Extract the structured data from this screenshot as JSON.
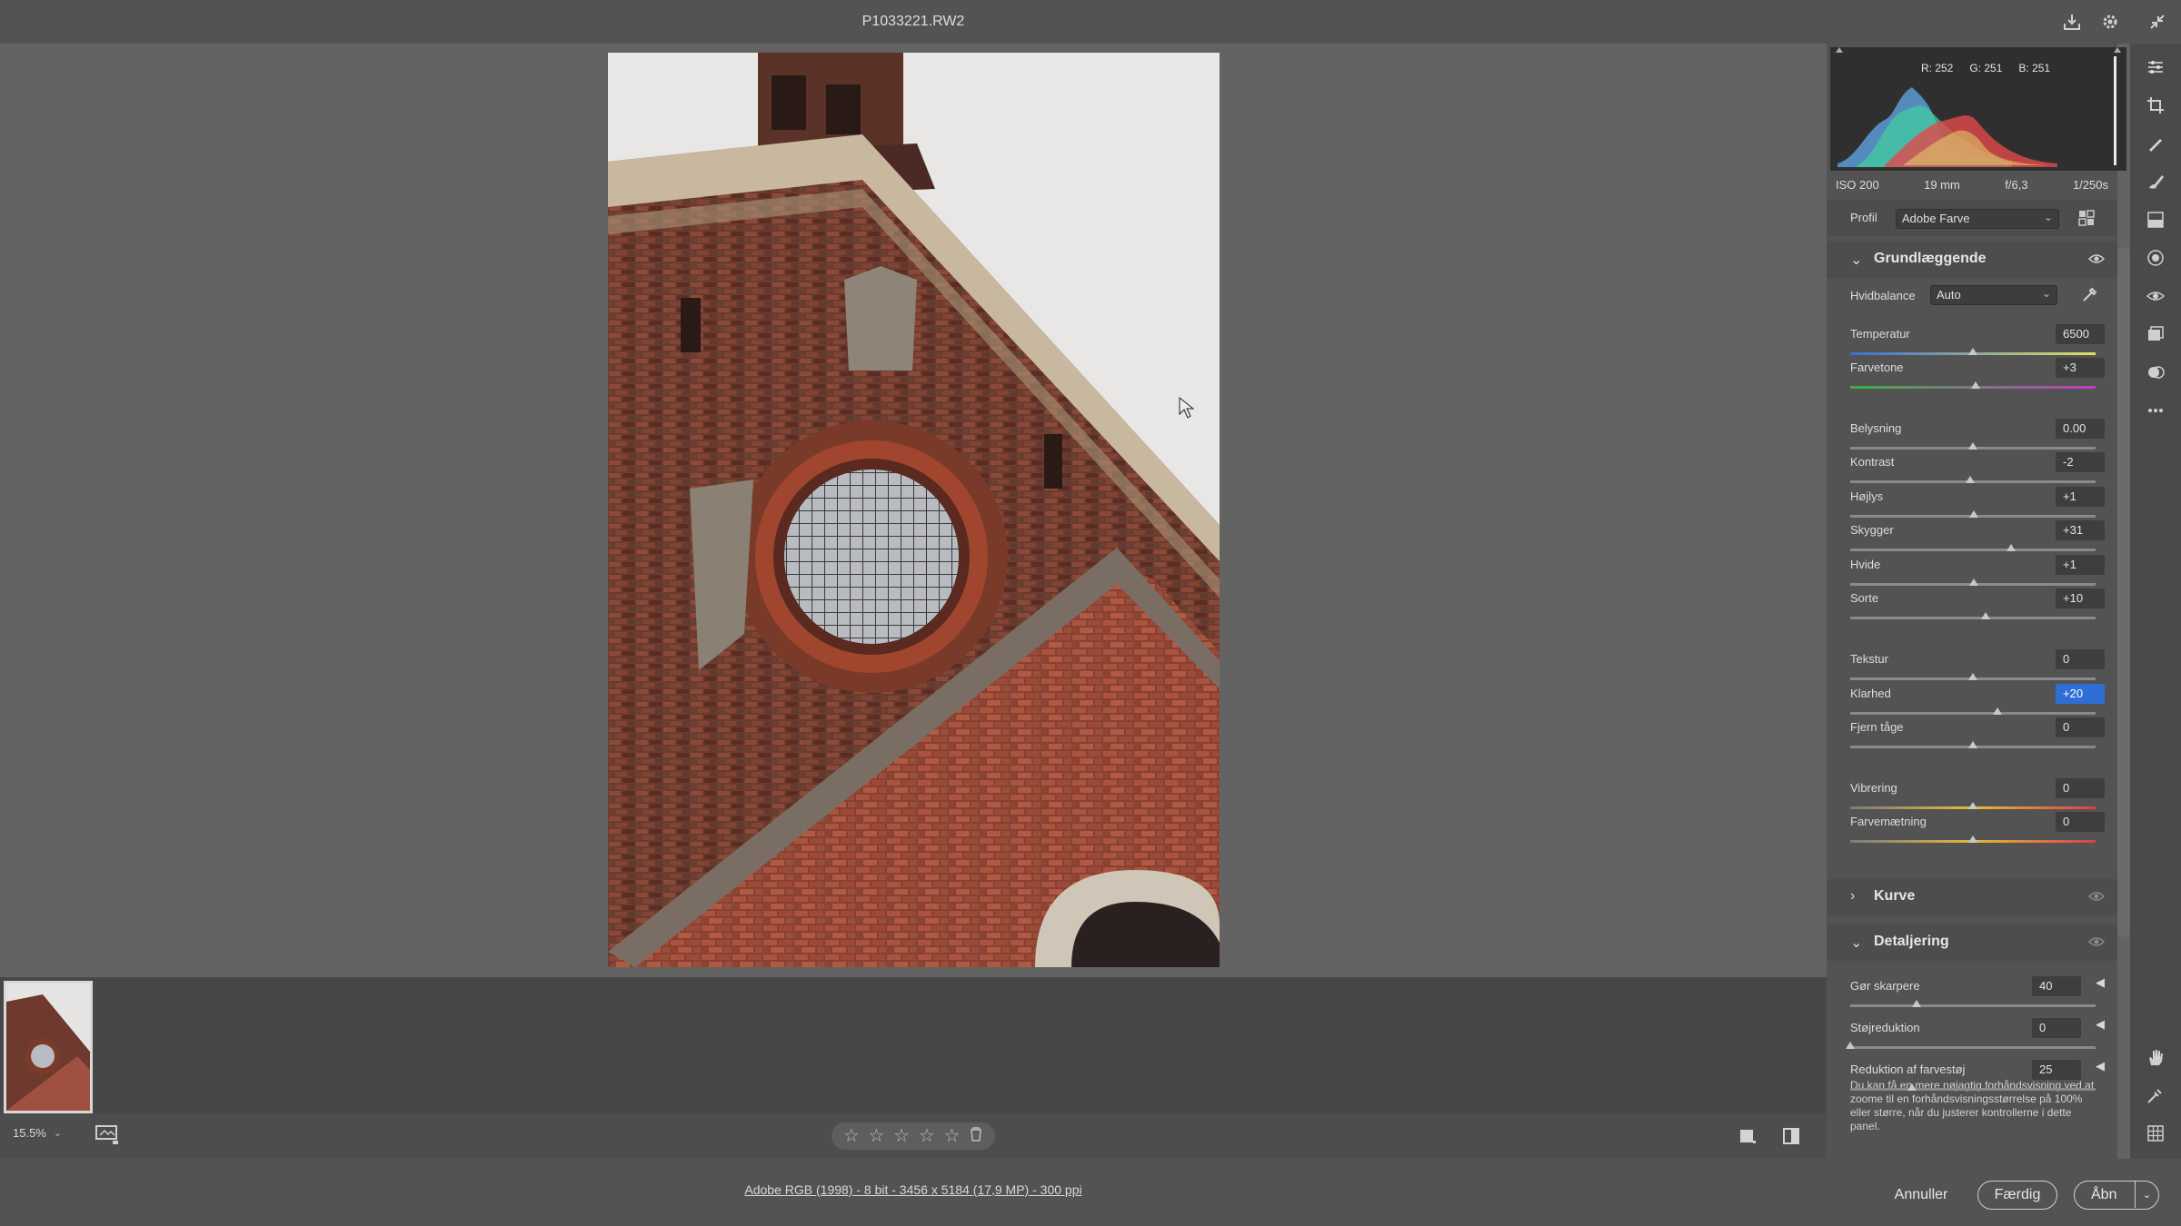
{
  "window": {
    "title": "P1033221.RW2"
  },
  "icons": {
    "export": "export-icon",
    "settings": "gear-icon",
    "fullscreen": "collapse-icon"
  },
  "histogram": {
    "r": "R: 252",
    "g": "G: 251",
    "b": "B: 251"
  },
  "exif": {
    "iso": "ISO 200",
    "focal": "19 mm",
    "aperture": "f/6,3",
    "shutter": "1/250s"
  },
  "profile": {
    "label": "Profil",
    "value": "Adobe Farve"
  },
  "sections": {
    "basic": "Grundlæggende",
    "curve": "Kurve",
    "detail": "Detaljering"
  },
  "white_balance": {
    "label": "Hvidbalance",
    "value": "Auto"
  },
  "sliders": {
    "temperature": {
      "label": "Temperatur",
      "value": "6500",
      "pos": 0.5
    },
    "tint": {
      "label": "Farvetone",
      "value": "+3",
      "pos": 0.51
    },
    "exposure": {
      "label": "Belysning",
      "value": "0.00",
      "pos": 0.5
    },
    "contrast": {
      "label": "Kontrast",
      "value": "-2",
      "pos": 0.49
    },
    "highlights": {
      "label": "Højlys",
      "value": "+1",
      "pos": 0.505
    },
    "shadows": {
      "label": "Skygger",
      "value": "+31",
      "pos": 0.655
    },
    "whites": {
      "label": "Hvide",
      "value": "+1",
      "pos": 0.505
    },
    "blacks": {
      "label": "Sorte",
      "value": "+10",
      "pos": 0.55
    },
    "texture": {
      "label": "Tekstur",
      "value": "0",
      "pos": 0.5
    },
    "clarity": {
      "label": "Klarhed",
      "value": "+20",
      "pos": 0.6
    },
    "dehaze": {
      "label": "Fjern tåge",
      "value": "0",
      "pos": 0.5
    },
    "vibrance": {
      "label": "Vibrering",
      "value": "0",
      "pos": 0.5
    },
    "saturation": {
      "label": "Farvemætning",
      "value": "0",
      "pos": 0.5
    },
    "sharpen": {
      "label": "Gør skarpere",
      "value": "40",
      "pos": 0.27
    },
    "noise": {
      "label": "Støjreduktion",
      "value": "0",
      "pos": 0.0
    },
    "color_noise": {
      "label": "Reduktion af farvestøj",
      "value": "25",
      "pos": 0.25
    }
  },
  "detail_notice": "Du kan få en mere nøjagtig forhåndsvisning ved at zoome til en forhåndsvisningsstørrelse på 100% eller større, når du justerer kontrollerne i dette panel.",
  "zoom": {
    "value": "15.5%"
  },
  "rating": {
    "stars": 0,
    "max": 5
  },
  "image_info": "Adobe RGB (1998) - 8 bit - 3456 x 5184 (17,9 MP) - 300 ppi",
  "buttons": {
    "cancel": "Annuller",
    "done": "Færdig",
    "open": "Åbn"
  },
  "colors": {
    "accent": "#2e6fd6",
    "panel": "#535353",
    "canvas": "#636363"
  }
}
